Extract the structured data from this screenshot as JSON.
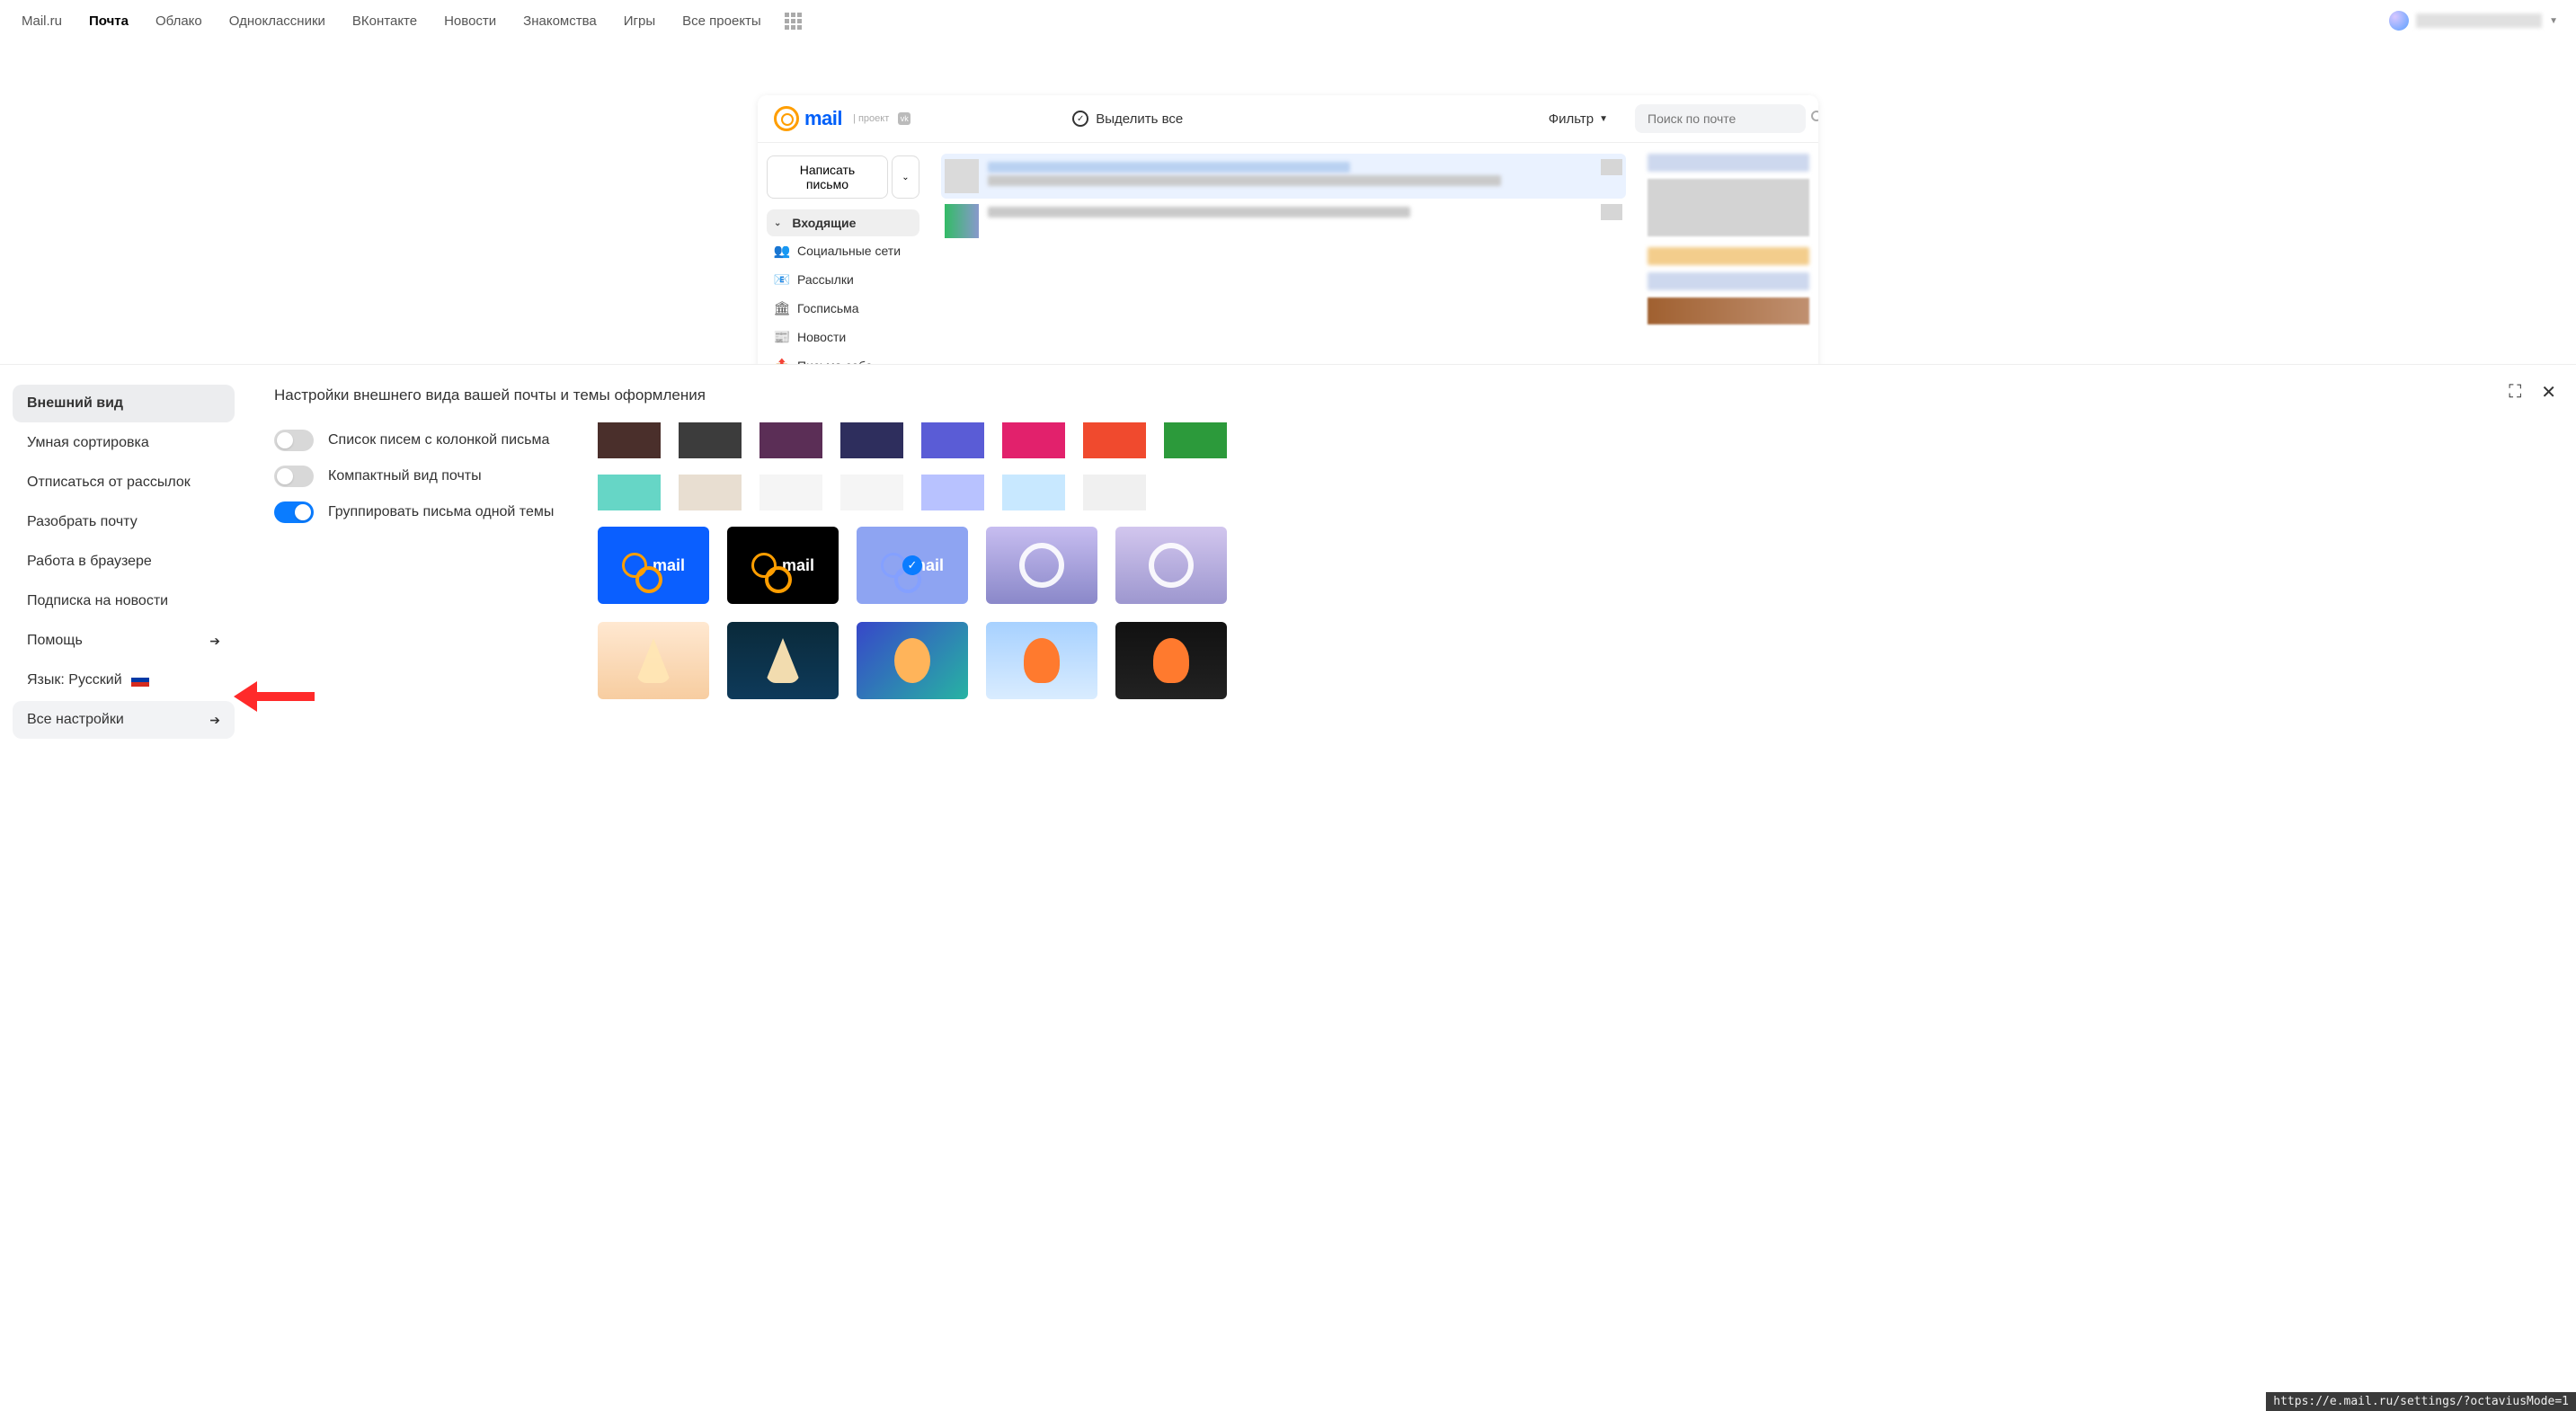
{
  "portal": {
    "links": [
      "Mail.ru",
      "Почта",
      "Облако",
      "Одноклассники",
      "ВКонтакте",
      "Новости",
      "Знакомства",
      "Игры",
      "Все проекты"
    ],
    "active_index": 1
  },
  "mail": {
    "logo_text": "mail",
    "logo_sub": "проект",
    "logo_badge": "vk",
    "select_all": "Выделить все",
    "filter": "Фильтр",
    "search_placeholder": "Поиск по почте",
    "compose": "Написать письмо",
    "folders": [
      {
        "name": "Входящие",
        "icon": "chevron",
        "active": true
      },
      {
        "name": "Социальные сети",
        "icon": "people"
      },
      {
        "name": "Рассылки",
        "icon": "newsletter"
      },
      {
        "name": "Госписьма",
        "icon": "gov"
      },
      {
        "name": "Новости",
        "icon": "news"
      },
      {
        "name": "Письма себе",
        "icon": "self"
      }
    ]
  },
  "settings": {
    "title": "Настройки внешнего вида вашей почты и темы оформления",
    "sidebar": {
      "items": [
        {
          "label": "Внешний вид",
          "active": true
        },
        {
          "label": "Умная сортировка"
        },
        {
          "label": "Отписаться от рассылок"
        },
        {
          "label": "Разобрать почту"
        },
        {
          "label": "Работа в браузере"
        },
        {
          "label": "Подписка на новости"
        },
        {
          "label": "Помощь",
          "arrow": true
        },
        {
          "label": "Язык: Русский",
          "flag": "ru"
        },
        {
          "label": "Все настройки",
          "arrow": true,
          "highlight": true
        }
      ]
    },
    "toggles": [
      {
        "label": "Список писем с колонкой письма",
        "on": false
      },
      {
        "label": "Компактный вид почты",
        "on": false
      },
      {
        "label": "Группировать письма одной темы",
        "on": true
      }
    ],
    "color_row1": [
      "#4a2f2b",
      "#3c3c3c",
      "#5b2e56",
      "#2e2e5d",
      "#5a5cd6",
      "#e2216c",
      "#f04a2e",
      "#2c9a3b"
    ],
    "color_row2": [
      "#66d6c6",
      "#e8ded1",
      "#f5f5f5",
      "#f5f5f5",
      "#b8c2ff",
      "#c8e8ff",
      "#f0f0f0"
    ],
    "theme_tiles_r1": [
      {
        "bg": "#0a5fff",
        "at": "#ff9e00",
        "text": "mail",
        "text_color": "#fff"
      },
      {
        "bg": "#000",
        "at": "#ff9e00",
        "text": "mail",
        "text_color": "#fff"
      },
      {
        "bg": "#8ea4f2",
        "at": "#84a0ff",
        "text": "mail",
        "text_color": "#fff",
        "selected": true
      },
      {
        "bg": "linear-gradient(180deg,#c7bdf0,#8a88c9)"
      },
      {
        "bg": "linear-gradient(180deg,#d2c6ee,#9d97cf)"
      }
    ],
    "theme_tiles_r2": [
      {
        "bg": "#fff"
      },
      {
        "bg": "#0e3a2e"
      },
      {
        "bg": "#2a3d8a"
      },
      {
        "bg": "#cfe6ff"
      },
      {
        "bg": "#111"
      }
    ]
  },
  "status_url": "https://e.mail.ru/settings/?octaviusMode=1"
}
